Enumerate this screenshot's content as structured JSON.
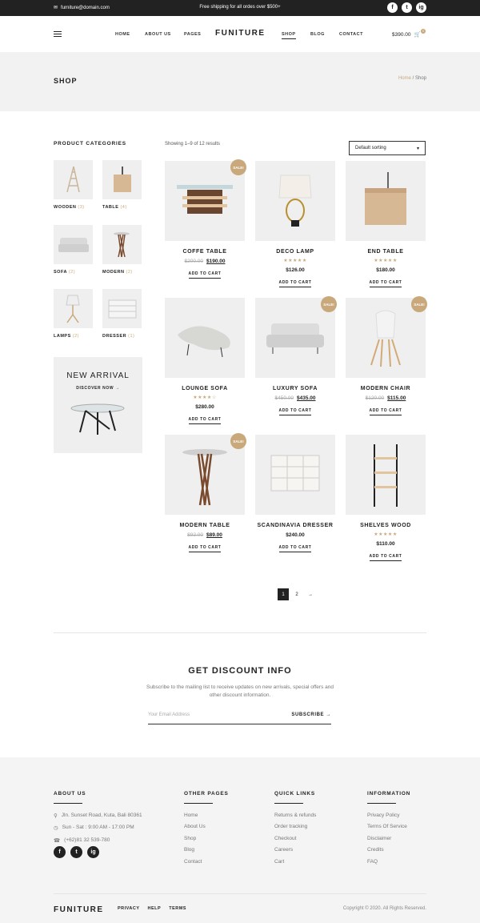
{
  "topbar": {
    "email": "furniture@domain.com",
    "shipping": "Free shipping for all ordes over $500+",
    "social": [
      "f",
      "t",
      "ig"
    ]
  },
  "nav": {
    "items": [
      "HOME",
      "ABOUT US",
      "PAGES",
      "SHOP",
      "BLOG",
      "CONTACT"
    ],
    "logo": "FUNITURE",
    "cart_total": "$390.00",
    "cart_count": "0"
  },
  "header": {
    "title": "SHOP",
    "crumb_home": "Home",
    "crumb_current": "/ Shop"
  },
  "sidebar": {
    "title": "PRODUCT CATEGORIES",
    "categories": [
      {
        "label": "WOODEN",
        "count": "(3)"
      },
      {
        "label": "TABLE",
        "count": "(4)"
      },
      {
        "label": "SOFA",
        "count": "(2)"
      },
      {
        "label": "MODERN",
        "count": "(2)"
      },
      {
        "label": "LAMPS",
        "count": "(2)"
      },
      {
        "label": "DRESSER",
        "count": "(1)"
      }
    ],
    "promo_title": "NEW ARRIVAL",
    "promo_link": "DISCOVER NOW →"
  },
  "shop": {
    "showing": "Showing 1–9 of 12 results",
    "sort": "Default sorting",
    "sale_badge": "SALE!",
    "add_label": "ADD TO CART",
    "products": [
      {
        "name": "COFFE TABLE",
        "old": "$200.00",
        "price": "$190.00",
        "sale": true,
        "stars": ""
      },
      {
        "name": "DECO LAMP",
        "old": "",
        "price": "$126.00",
        "sale": false,
        "stars": "★★★★★"
      },
      {
        "name": "END TABLE",
        "old": "",
        "price": "$180.00",
        "sale": false,
        "stars": "★★★★★"
      },
      {
        "name": "LOUNGE SOFA",
        "old": "",
        "price": "$280.00",
        "sale": false,
        "stars": "★★★★☆"
      },
      {
        "name": "LUXURY SOFA",
        "old": "$450.00",
        "price": "$435.00",
        "sale": true,
        "stars": ""
      },
      {
        "name": "MODERN CHAIR",
        "old": "$120.00",
        "price": "$115.00",
        "sale": true,
        "stars": ""
      },
      {
        "name": "MODERN TABLE",
        "old": "$92.00",
        "price": "$89.00",
        "sale": true,
        "stars": ""
      },
      {
        "name": "SCANDINAVIA DRESSER",
        "old": "",
        "price": "$240.00",
        "sale": false,
        "stars": ""
      },
      {
        "name": "SHELVES WOOD",
        "old": "",
        "price": "$110.00",
        "sale": false,
        "stars": "★★★★★"
      }
    ],
    "pages": [
      "1",
      "2",
      "→"
    ]
  },
  "discount": {
    "title": "GET DISCOUNT INFO",
    "text": "Subscribe to the mailing list to receive updates on new arrivals, special offers and other discount information.",
    "placeholder": "Your Email Address",
    "button": "SUBSCRIBE →"
  },
  "footer": {
    "about_title": "ABOUT US",
    "address": "Jln. Sunset Road, Kuta, Bali 80361",
    "hours": "Sun - Sat : 9:00 AM - 17:00 PM",
    "phone": "(+62)81 32 539-780",
    "other_title": "OTHER PAGES",
    "other": [
      "Home",
      "About Us",
      "Shop",
      "Blog",
      "Contact"
    ],
    "quick_title": "QUICK LINKS",
    "quick": [
      "Returns & refunds",
      "Order tracking",
      "Checkout",
      "Careers",
      "Cart"
    ],
    "info_title": "INFORMATION",
    "info": [
      "Privacy Policy",
      "Terms Of Service",
      "Disclaimer",
      "Credits",
      "FAQ"
    ],
    "logo": "FUNITURE",
    "links": [
      "PRIVACY",
      "HELP",
      "TERMS"
    ],
    "copyright": "Copyright © 2020. All Rights Reserved.",
    "social": [
      "f",
      "t",
      "ig"
    ]
  },
  "colors": {
    "accent": "#c9a87c",
    "dark": "#222222",
    "light_bg": "#f2f2f2"
  }
}
